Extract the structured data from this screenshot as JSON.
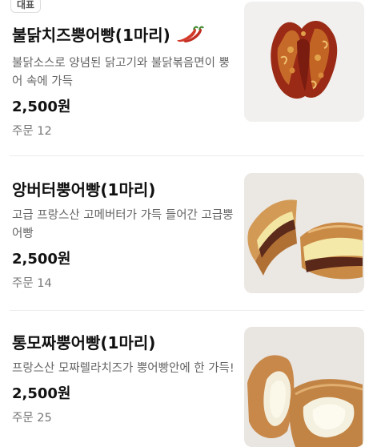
{
  "menu": {
    "items": [
      {
        "badge": "대표",
        "name": "불닭치즈뿡어빵(1마리)",
        "spicy_icon": "chili-pepper-icon",
        "description": "불닭소스로 양념된 닭고기와 불닭볶음면이 뿡어 속에 가득",
        "price": "2,500원",
        "orders": "주문 12"
      },
      {
        "name": "앙버터뿡어빵(1마리)",
        "description": "고급 프랑스산 고메버터가 가득 들어간 고급뿡어빵",
        "price": "2,500원",
        "orders": "주문 14"
      },
      {
        "name": "통모짜뿡어빵(1마리)",
        "description": "프랑스산 모짜렐라치즈가 뿡어빵안에 한 가득!",
        "price": "2,500원",
        "orders": "주문 25"
      }
    ]
  },
  "colors": {
    "spicy": "#c8352b",
    "divider": "#ececec"
  }
}
